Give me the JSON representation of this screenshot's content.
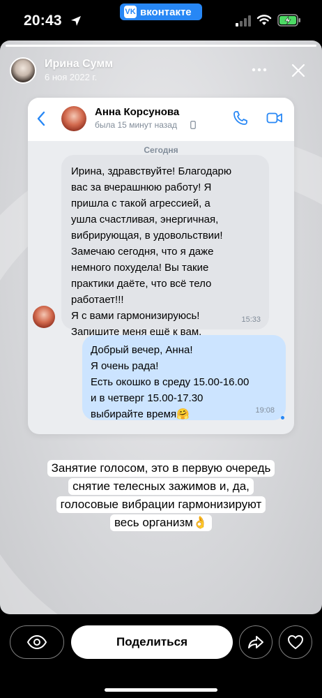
{
  "status_bar": {
    "time": "20:43",
    "back_app": "вконтакте",
    "back_app_logo": "VK",
    "icons": [
      "location-arrow-icon",
      "signal-icon",
      "wifi-icon",
      "battery-charging-icon"
    ]
  },
  "story": {
    "author_name": "Ирина Сумм",
    "date": "6 ноя 2022 г.",
    "progress": 1.0
  },
  "chat": {
    "contact_name": "Анна Корсунова",
    "contact_status": "была 15 минут назад",
    "date_separator": "Сегодня",
    "messages": [
      {
        "direction": "incoming",
        "text": "Ирина, здравствуйте! Благодарю\nвас за вчерашнюю работу! Я\nпришла с такой агрессией, а\nушла счастливая, энергичная,\nвибрирующая, в удовольствии!\nЗамечаю сегодня, что я даже\nнемного похудела! Вы такие\nпрактики даёте, что всё тело\nработает!!!\nЯ с вами гармонизируюсь!\nЗапишите меня ещё к вам.",
        "time": "15:33"
      },
      {
        "direction": "outgoing",
        "text": "Добрый вечер, Анна!\nЯ очень рада!\nЕсть окошко в среду 15.00-16.00\nи в четверг 15.00-17.30\nвыбирайте время🤗",
        "time": "19:08"
      }
    ]
  },
  "caption": {
    "lines": [
      "Занятие голосом, это в первую очередь",
      "снятие телесных зажимов и, да,",
      "голосовые вибрации гармонизируют",
      "весь организм👌"
    ]
  },
  "bottom_bar": {
    "share_label": "Поделиться"
  },
  "colors": {
    "vk_blue": "#2787f5",
    "outgoing_bubble": "#cce4ff",
    "incoming_bubble": "#e2e4e8",
    "charging_green": "#4cd964"
  }
}
